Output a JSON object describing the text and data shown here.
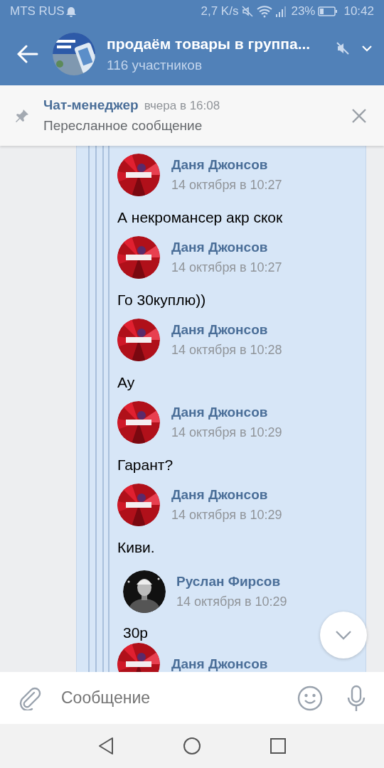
{
  "status_bar": {
    "carrier": "MTS RUS",
    "speed": "2,7 K/s",
    "battery": "23%",
    "time": "10:42"
  },
  "header": {
    "title": "продаём товары в группа...",
    "subtitle": "116 участников",
    "muted": true
  },
  "pinned": {
    "author": "Чат-менеджер",
    "time": "вчера в 16:08",
    "text": "Пересланное сообщение"
  },
  "messages": [
    {
      "name": "Даня Джонсов",
      "date": "14 октября в 10:27",
      "text": "А некромансер акр скок"
    },
    {
      "name": "Даня Джонсов",
      "date": "14 октября в 10:27",
      "text": "Го 30куплю))"
    },
    {
      "name": "Даня Джонсов",
      "date": "14 октября в 10:28",
      "text": "Ау"
    },
    {
      "name": "Даня Джонсов",
      "date": "14 октября в 10:29",
      "text": "Гарант?"
    },
    {
      "name": "Даня Джонсов",
      "date": "14 октября в 10:29",
      "text": "Киви.",
      "children": [
        {
          "name": "Руслан Фирсов",
          "date": "14 октября в 10:29",
          "text": "30р"
        }
      ]
    },
    {
      "name": "Даня Джонсов"
    }
  ],
  "composer": {
    "placeholder": "Сообщение"
  }
}
